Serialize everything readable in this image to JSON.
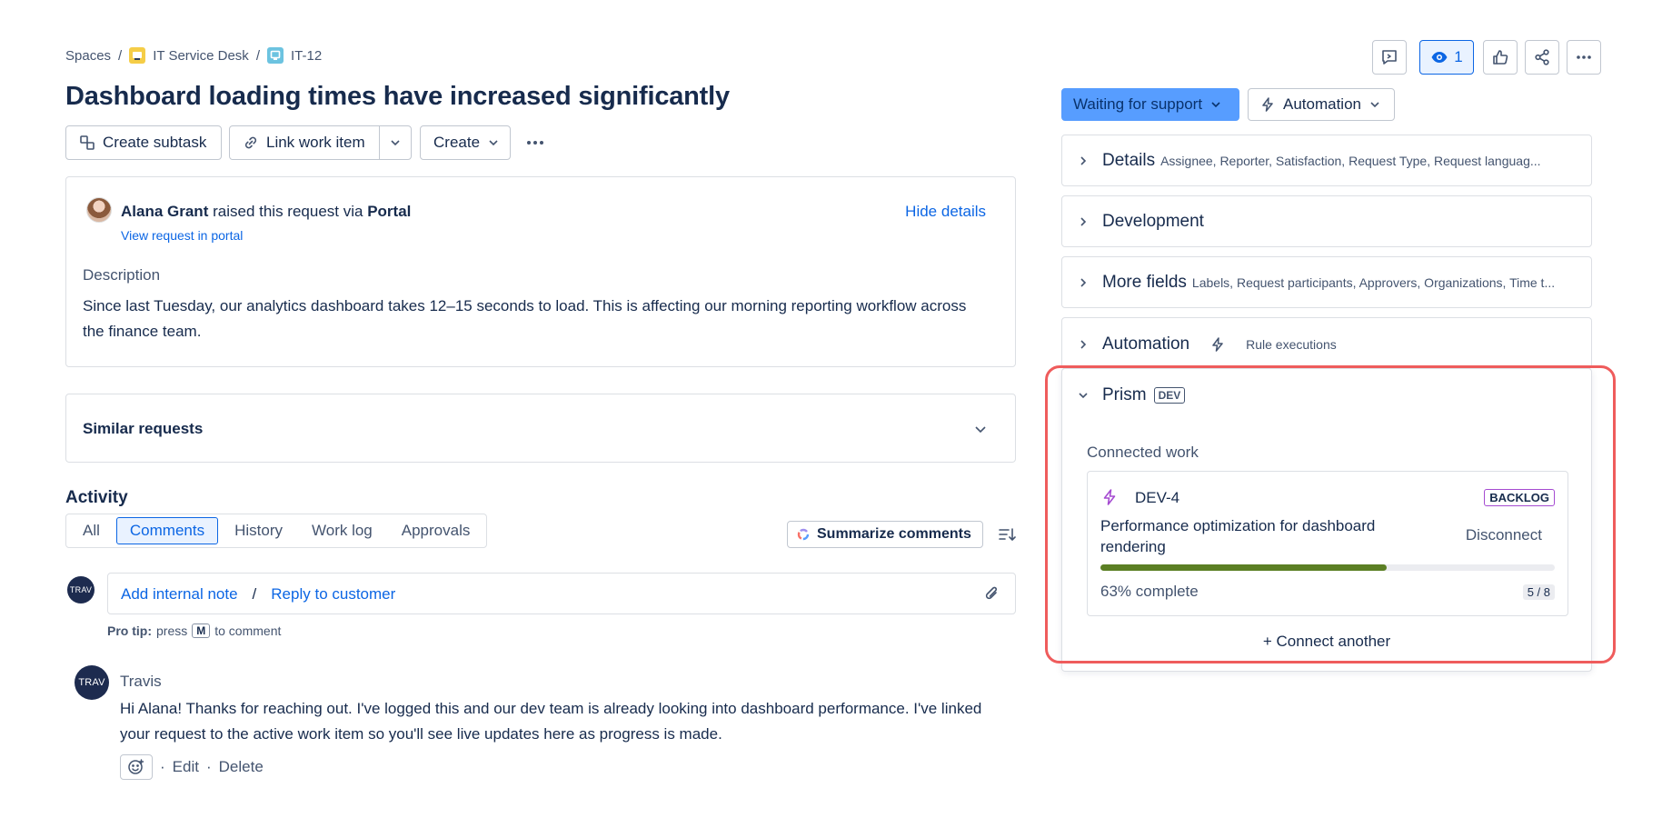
{
  "breadcrumb": {
    "spaces": "Spaces",
    "sep": "/",
    "project": "IT Service Desk",
    "issue_key": "IT-12"
  },
  "title": "Dashboard loading times have increased significantly",
  "toolbar": {
    "create_subtask": "Create subtask",
    "link_work_item": "Link work item",
    "create": "Create"
  },
  "request": {
    "reporter": "Alana Grant",
    "raised_text": "raised this request via",
    "channel": "Portal",
    "view_portal": "View request in portal",
    "hide_details": "Hide details",
    "description_label": "Description",
    "description_line1": "Since last Tuesday, our analytics dashboard takes 12–15 seconds to load. This is affecting our morning reporting workflow across",
    "description_line2": "the finance team."
  },
  "similar_requests": "Similar requests",
  "activity": {
    "heading": "Activity",
    "tabs": [
      "All",
      "Comments",
      "History",
      "Work log",
      "Approvals"
    ],
    "summarize": "Summarize comments",
    "add_internal_note": "Add internal note",
    "slash": "/",
    "reply_to_customer": "Reply to customer",
    "pro_tip_label": "Pro tip:",
    "pro_tip_press": "press",
    "pro_tip_key": "M",
    "pro_tip_rest": "to comment",
    "avatar_initials": "TRAV"
  },
  "comment": {
    "author": "Travis",
    "avatar_initials": "TRAV",
    "line1": "Hi Alana! Thanks for reaching out. I've logged this and our dev team is already looking into dashboard performance. I've linked",
    "line2": "your request to the active work item so you'll see live updates here as progress is made.",
    "dot": "·",
    "edit": "Edit",
    "delete": "Delete"
  },
  "header_actions": {
    "watch_count": "1"
  },
  "status": {
    "label": "Waiting for support",
    "automation": "Automation"
  },
  "panels": {
    "details_title": "Details",
    "details_sub": "Assignee, Reporter, Satisfaction, Request Type, Request languag...",
    "development_title": "Development",
    "more_fields_title": "More fields",
    "more_fields_sub": "Labels, Request participants, Approvers, Organizations, Time t...",
    "automation_title": "Automation",
    "automation_sub": "Rule executions"
  },
  "prism": {
    "title": "Prism",
    "badge": "DEV",
    "connected_label": "Connected work",
    "item_key": "DEV-4",
    "item_status": "BACKLOG",
    "item_title_line1": "Performance optimization for dashboard",
    "item_title_line2": "rendering",
    "disconnect": "Disconnect",
    "progress_fraction": 0.63,
    "progress_text": "63% complete",
    "progress_count": "5 / 8",
    "connect_another": "+ Connect another"
  },
  "colors": {
    "accent": "#0c66e4",
    "status_bg": "#579dff",
    "progress": "#5b7f24",
    "highlight": "#ef5c5c",
    "prism_purple": "#a54bd1"
  }
}
